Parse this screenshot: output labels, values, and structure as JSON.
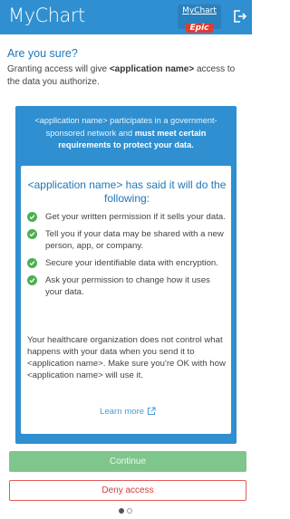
{
  "header": {
    "logo_text": "MyChart",
    "badge_top": "MyChart",
    "badge_bottom": "Epic",
    "logout_icon": "logout-icon"
  },
  "dialog": {
    "title": "Are you sure?",
    "intro_prefix": "Granting access will give ",
    "intro_app": "<application name>",
    "intro_suffix": " access to the data you authorize."
  },
  "panel": {
    "note_plain": "<application name> participates in a government-sponsored network and ",
    "note_bold": "must meet certain requirements to protect your data."
  },
  "card": {
    "title": "<application name> has said it will do the following:",
    "bullets": [
      "Get your written permission if it sells your data.",
      "Tell you if your data may be shared with a new person, app, or company.",
      "Secure your identifiable data with encryption.",
      "Ask your permission to change how it uses your data."
    ],
    "disclaimer": "Your healthcare organization does not control what happens with your data when you send it to <application name>. Make sure you're OK with how <application name> will use it.",
    "learn_more": "Learn more"
  },
  "actions": {
    "continue_label": "Continue",
    "deny_label": "Deny access"
  },
  "pagination": {
    "current": 1,
    "total": 2
  },
  "colors": {
    "brand_blue": "#2f8fd0",
    "title_blue": "#1f76b8",
    "check_green": "#4caf50",
    "continue_green": "#7fc68d",
    "deny_red": "#d23b3b"
  }
}
